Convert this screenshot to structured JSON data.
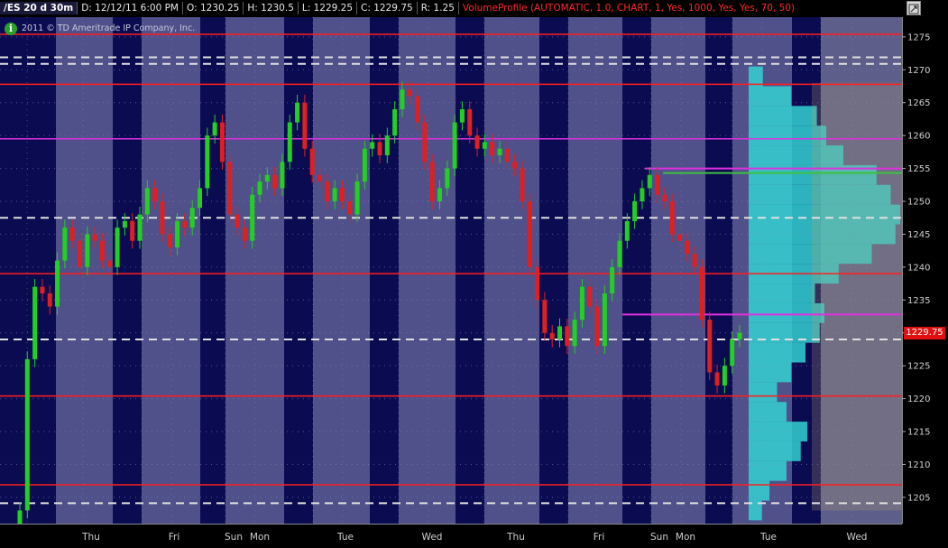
{
  "header": {
    "symbol": "/ES 20 d 30m",
    "date": "D: 12/12/11 6:00 PM",
    "open": "O: 1230.25",
    "high": "H: 1230.5",
    "low": "L: 1229.25",
    "close": "C: 1229.75",
    "range": "R: 1.25",
    "study": "VolumeProfile (AUTOMATIC, 1.0, CHART, 1, Yes, 1000, Yes, Yes, 70, 50)"
  },
  "copyright": "2011 © TD Ameritrade IP Company, Inc.",
  "price_badge": "1229.75",
  "colors": {
    "plot_bg": "#50508a",
    "night_band": "#0b0b52",
    "red_line": "#ff1e1e",
    "magenta_line": "#e030e0",
    "green_line": "#40c040",
    "white_dash": "#e0e0e0",
    "profile": "#33d1d1",
    "up_candle": "#22d022",
    "down_candle": "#e02020",
    "axis_text": "#cfcfcf",
    "price_badge": "#e01010"
  },
  "chart_data": {
    "type": "candlestick",
    "title": "/ES 20 d 30m",
    "ylim": [
      1201,
      1278
    ],
    "y_ticks": [
      1205,
      1210,
      1215,
      1220,
      1225,
      1230,
      1235,
      1240,
      1245,
      1250,
      1255,
      1260,
      1265,
      1270,
      1275
    ],
    "x_labels": [
      "Thu",
      "Fri",
      "Sun",
      "Mon",
      "Tue",
      "Wed",
      "Thu",
      "Fri",
      "Sun",
      "Mon",
      "Tue",
      "Wed"
    ],
    "grid": true,
    "horizontal_lines": [
      {
        "price": 1275.4,
        "color": "red",
        "style": "solid"
      },
      {
        "price": 1271.9,
        "color": "white",
        "style": "dashed"
      },
      {
        "price": 1270.9,
        "color": "white",
        "style": "dashed"
      },
      {
        "price": 1267.8,
        "color": "red",
        "style": "solid"
      },
      {
        "price": 1259.5,
        "color": "magenta",
        "style": "solid"
      },
      {
        "price": 1247.5,
        "color": "white",
        "style": "dashed"
      },
      {
        "price": 1239.0,
        "color": "red",
        "style": "solid"
      },
      {
        "price": 1229.0,
        "color": "white",
        "style": "dashed"
      },
      {
        "price": 1220.4,
        "color": "red",
        "style": "solid"
      },
      {
        "price": 1206.9,
        "color": "red",
        "style": "solid"
      },
      {
        "price": 1204.1,
        "color": "white",
        "style": "dashed"
      }
    ],
    "profile_lines": [
      {
        "price": 1255.0,
        "color": "magenta"
      },
      {
        "price": 1254.3,
        "color": "green"
      },
      {
        "price": 1232.8,
        "color": "magenta"
      }
    ],
    "series": [
      {
        "values": [
          1203,
          1226,
          1237,
          1236,
          1234,
          1241,
          1246,
          1244,
          1240,
          1245,
          1244,
          1241,
          1240,
          1246,
          1247,
          1244,
          1248,
          1252,
          1250,
          1245,
          1243,
          1247,
          1246,
          1249,
          1252,
          1260,
          1262,
          1256,
          1248,
          1246,
          1244,
          1251,
          1253,
          1254,
          1252,
          1256,
          1262,
          1265,
          1258,
          1254,
          1253,
          1250,
          1252,
          1250,
          1248,
          1253,
          1258,
          1259,
          1257,
          1260,
          1264,
          1267,
          1266,
          1262,
          1256,
          1250,
          1252,
          1255,
          1262,
          1264,
          1260,
          1258,
          1259,
          1257,
          1258,
          1256,
          1255,
          1250,
          1240,
          1235,
          1230,
          1229,
          1231,
          1228,
          1232,
          1237,
          1234,
          1228,
          1236,
          1240,
          1244,
          1247,
          1250,
          1252,
          1254,
          1251,
          1250,
          1245,
          1244,
          1242,
          1240,
          1232,
          1224,
          1222,
          1225,
          1229,
          1230
        ]
      }
    ],
    "volume_profile": {
      "prices": [
        1203,
        1206,
        1209,
        1212,
        1215,
        1218,
        1221,
        1224,
        1227,
        1230,
        1233,
        1236,
        1239,
        1242,
        1245,
        1248,
        1251,
        1254,
        1257,
        1260,
        1263,
        1266,
        1269
      ],
      "values": [
        14,
        22,
        40,
        55,
        62,
        40,
        30,
        45,
        60,
        75,
        80,
        70,
        95,
        130,
        155,
        160,
        150,
        135,
        100,
        82,
        72,
        45,
        15
      ]
    }
  }
}
